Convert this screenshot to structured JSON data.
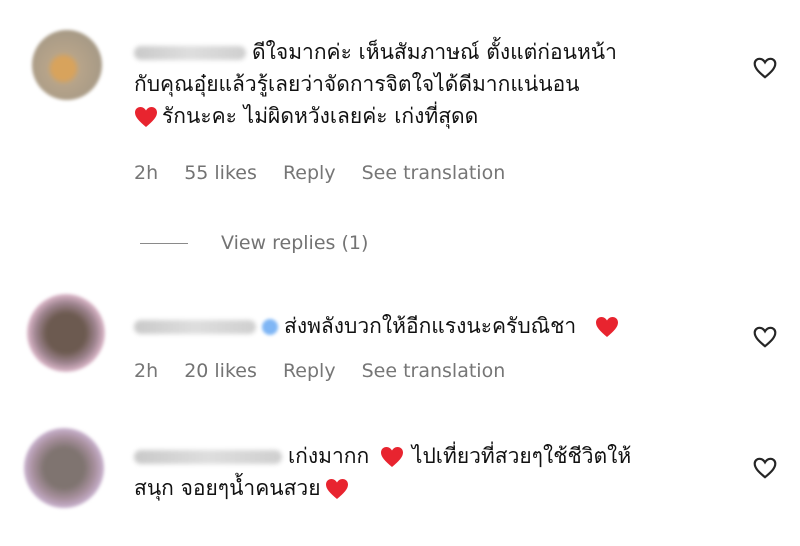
{
  "comments": [
    {
      "avatar_color": "#c9b08a",
      "lines": [
        "ดีใจมากค่ะ เห็นสัมภาษณ์ ตั้งแต่ก่อนหน้า",
        "กับคุณอุ๋ยแล้วรู้เลยว่าจัดการจิตใจได้ดีมากแน่นอน",
        "รักนะคะ ไม่ผิดหวังเลยค่ะ เก่งที่สุดด"
      ],
      "time": "2h",
      "likes": "55 likes",
      "reply": "Reply",
      "translate": "See translation"
    },
    {
      "avatar_color": "#6b5a55",
      "text": "ส่งพลังบวกให้อีกแรงนะครับณิชา",
      "time": "2h",
      "likes": "20 likes",
      "reply": "Reply",
      "translate": "See translation"
    },
    {
      "avatar_color": "#8a7a80",
      "line1": "เก่งมากก",
      "line1b": "ไปเที่ยวที่สวยๆใช้ชีวิตให้",
      "line2": "สนุก จอยๆน้ำคนสวย"
    }
  ],
  "view_replies": "View replies (1)",
  "colors": {
    "heart_red": "#e8242f",
    "meta_gray": "#737373"
  }
}
